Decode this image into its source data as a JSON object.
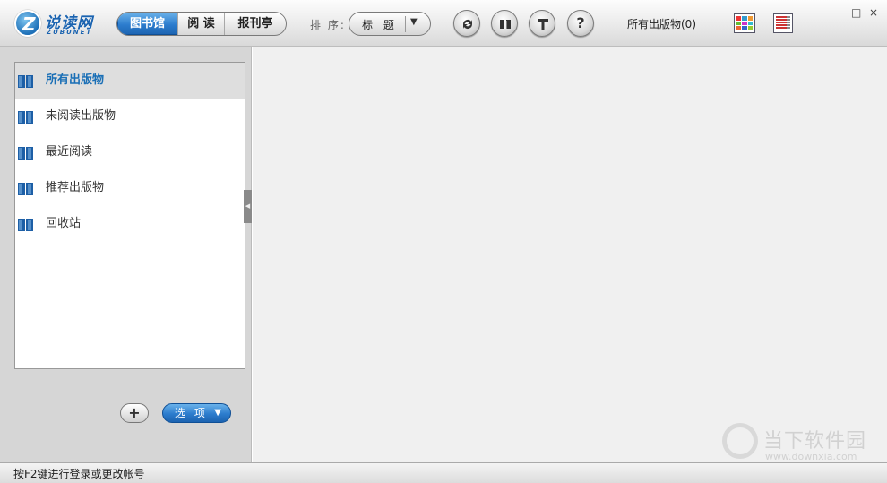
{
  "logo": {
    "name": "说读网",
    "sub": "ZUBUNET"
  },
  "tabs": [
    {
      "label": "图书馆",
      "active": true
    },
    {
      "label": "阅 读",
      "active": false
    },
    {
      "label": "报刊亭",
      "active": false
    }
  ],
  "sort": {
    "label": "排 序:",
    "value": "标 题"
  },
  "toolbar_icons": [
    "sync-icon",
    "book-open-icon",
    "text-icon",
    "help-icon"
  ],
  "publication_count": "所有出版物(0)",
  "window_controls": {
    "minimize": "–",
    "maximize": "□",
    "close": "×"
  },
  "sidebar": {
    "items": [
      {
        "label": "所有出版物",
        "active": true
      },
      {
        "label": "未阅读出版物",
        "active": false
      },
      {
        "label": "最近阅读",
        "active": false
      },
      {
        "label": "推荐出版物",
        "active": false
      },
      {
        "label": "回收站",
        "active": false
      }
    ],
    "add_label": "+",
    "options_label": "选 项"
  },
  "watermark": {
    "name": "当下软件园",
    "url": "www.downxia.com"
  },
  "status": "按F2键进行登录或更改帐号",
  "colors": {
    "accent": "#2c7ccd",
    "active_text": "#1a6fb6",
    "sidebar_bg": "#d6d6d6",
    "content_bg": "#f0f0f0"
  }
}
